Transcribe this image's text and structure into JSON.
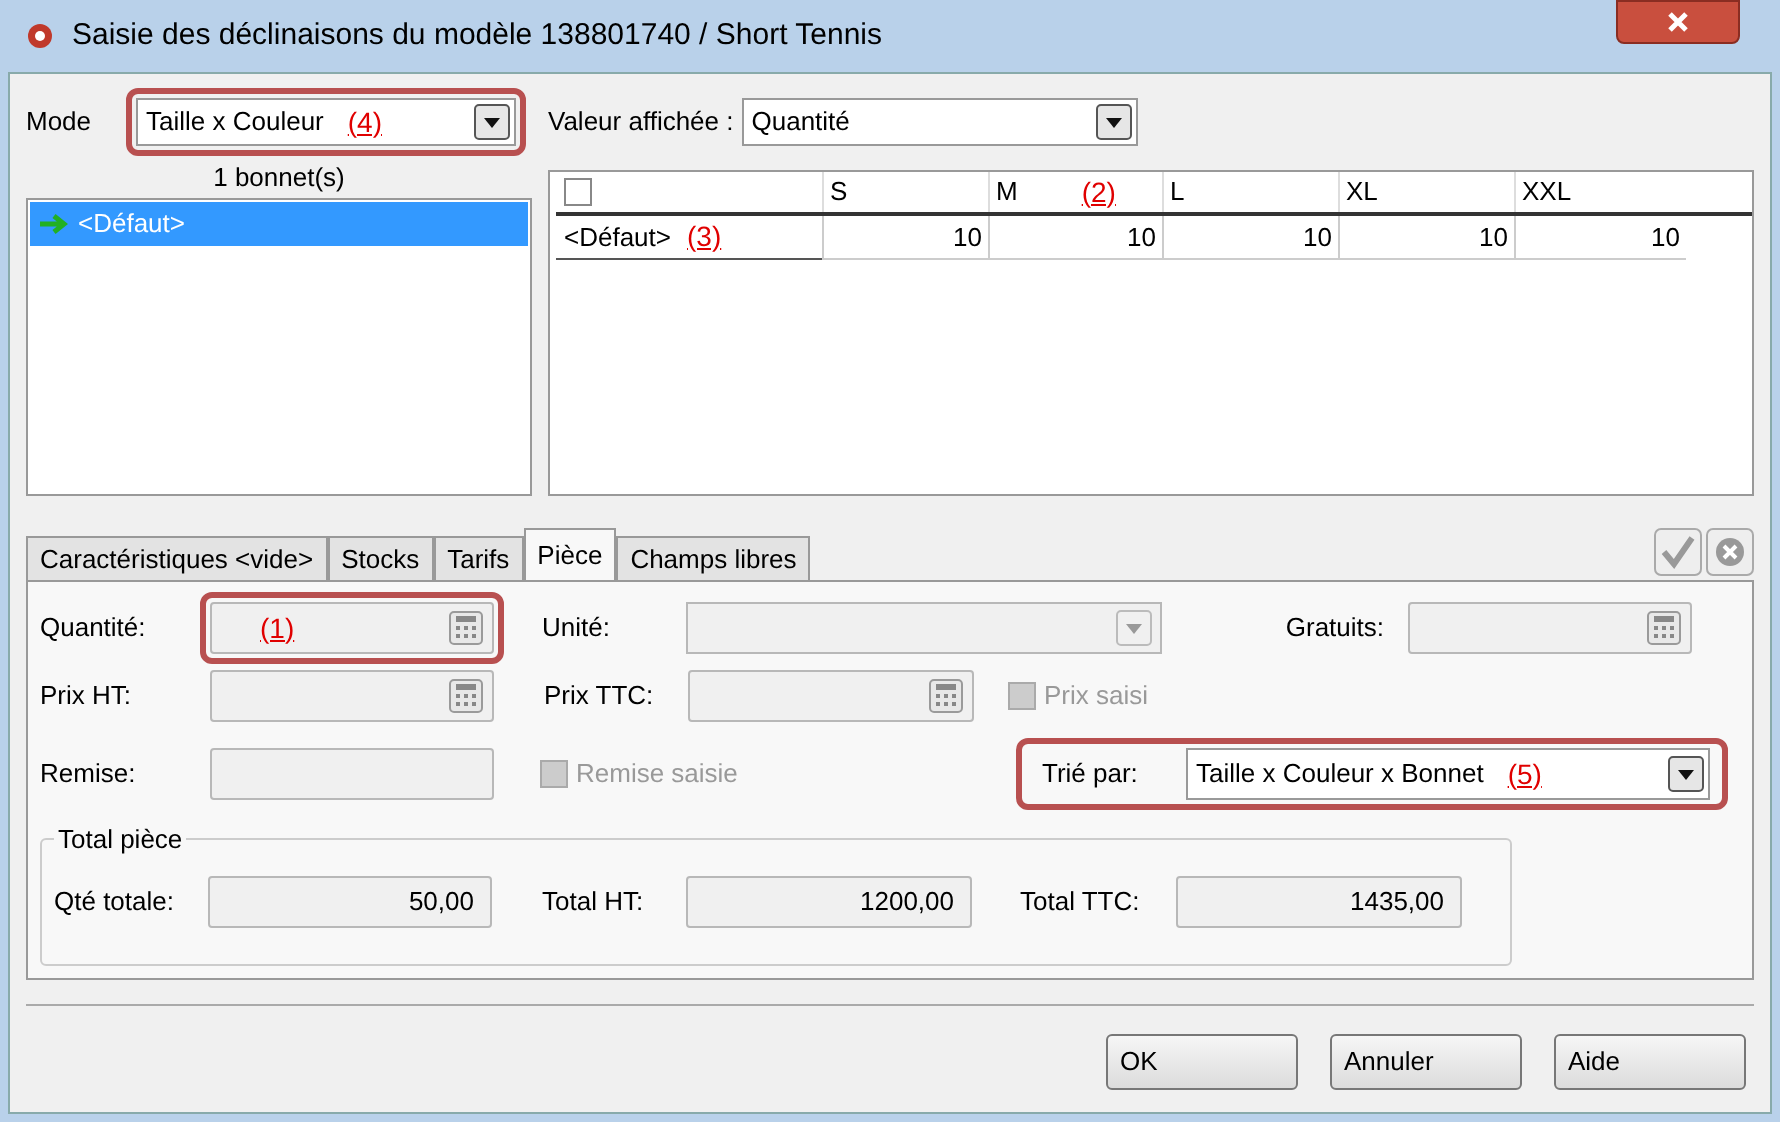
{
  "window": {
    "title": "Saisie des déclinaisons du modèle 138801740 / Short Tennis"
  },
  "mode": {
    "label": "Mode",
    "value": "Taille x Couleur",
    "callout": "(4)"
  },
  "bonnets": {
    "count_label": "1 bonnet(s)",
    "items": [
      {
        "label": "<Défaut>",
        "selected": true
      }
    ]
  },
  "display": {
    "label": "Valeur affichée :",
    "value": "Quantité"
  },
  "grid": {
    "header_checked": false,
    "columns": [
      {
        "label": "S"
      },
      {
        "label": "M",
        "callout": "(2)"
      },
      {
        "label": "L"
      },
      {
        "label": "XL"
      },
      {
        "label": "XXL"
      }
    ],
    "rows": [
      {
        "label": "<Défaut>",
        "callout": "(3)",
        "cells": [
          "10",
          "10",
          "10",
          "10",
          "10"
        ]
      }
    ]
  },
  "tabs": [
    {
      "label": "Caractéristiques <vide>",
      "selected": false
    },
    {
      "label": "Stocks",
      "selected": false
    },
    {
      "label": "Tarifs",
      "selected": false
    },
    {
      "label": "Pièce",
      "selected": true
    },
    {
      "label": "Champs libres",
      "selected": false
    }
  ],
  "piece": {
    "quantite": {
      "label": "Quantité:",
      "callout": "(1)"
    },
    "unite": {
      "label": "Unité:"
    },
    "gratuits": {
      "label": "Gratuits:"
    },
    "prix_ht": {
      "label": "Prix HT:"
    },
    "prix_ttc": {
      "label": "Prix TTC:"
    },
    "prix_saisi": {
      "label": "Prix saisi",
      "checked": false,
      "disabled": true
    },
    "remise": {
      "label": "Remise:"
    },
    "remise_saisie": {
      "label": "Remise saisie",
      "checked": false,
      "disabled": true
    },
    "trie_par": {
      "label": "Trié par:",
      "value": "Taille x Couleur x Bonnet",
      "callout": "(5)"
    },
    "total": {
      "title": "Total pièce",
      "qte": {
        "label": "Qté totale:",
        "value": "50,00"
      },
      "ht": {
        "label": "Total HT:",
        "value": "1200,00"
      },
      "ttc": {
        "label": "Total TTC:",
        "value": "1435,00"
      }
    }
  },
  "buttons": [
    "OK",
    "Annuler",
    "Aide"
  ]
}
